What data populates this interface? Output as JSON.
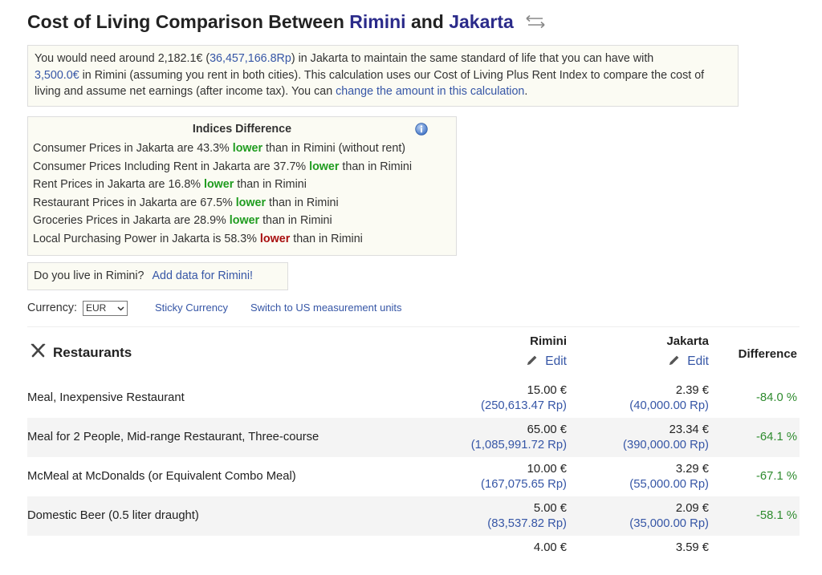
{
  "title": {
    "prefix": "Cost of Living Comparison Between",
    "city1": "Rimini",
    "and": "and",
    "city2": "Jakarta"
  },
  "summary": {
    "t1": "You would need around 2,182.1€ (",
    "amount_rp": "36,457,166.8Rp",
    "t2": ") in Jakarta to maintain the same standard of life that you can have with",
    "amount_eur": "3,500.0€",
    "t3": " in Rimini (assuming you rent in both cities). This calculation uses our Cost of Living Plus Rent Index to compare the cost of living and assume net earnings (after income tax). You can ",
    "link": "change the amount in this calculation",
    "t4": "."
  },
  "indices": {
    "heading": "Indices Difference",
    "rows": [
      {
        "pre": "Consumer Prices in Jakarta are 43.3% ",
        "word": "lower",
        "post": " than in Rimini (without rent)"
      },
      {
        "pre": "Consumer Prices Including Rent in Jakarta are 37.7% ",
        "word": "lower",
        "post": " than in Rimini"
      },
      {
        "pre": "Rent Prices in Jakarta are 16.8% ",
        "word": "lower",
        "post": " than in Rimini"
      },
      {
        "pre": "Restaurant Prices in Jakarta are 67.5% ",
        "word": "lower",
        "post": " than in Rimini"
      },
      {
        "pre": "Groceries Prices in Jakarta are 28.9% ",
        "word": "lower",
        "post": " than in Rimini"
      },
      {
        "pre": "Local Purchasing Power in Jakarta is 58.3% ",
        "word": "lower",
        "post": " than in Rimini"
      }
    ]
  },
  "live": {
    "question": "Do you live in Rimini?",
    "link": "Add data for Rimini!"
  },
  "currency": {
    "label": "Currency:",
    "selected": "EUR",
    "sticky": "Sticky Currency",
    "units": "Switch to US measurement units"
  },
  "table": {
    "category": "Restaurants",
    "col_rimini": "Rimini",
    "col_jakarta": "Jakarta",
    "edit": "Edit",
    "col_difference": "Difference",
    "rows": [
      {
        "item": "Meal, Inexpensive Restaurant",
        "rim_eur": "15.00 €",
        "rim_rp": "(250,613.47 Rp)",
        "jak_eur": "2.39 €",
        "jak_rp": "(40,000.00 Rp)",
        "diff": "-84.0 %"
      },
      {
        "item": "Meal for 2 People, Mid-range Restaurant, Three-course",
        "rim_eur": "65.00 €",
        "rim_rp": "(1,085,991.72 Rp)",
        "jak_eur": "23.34 €",
        "jak_rp": "(390,000.00 Rp)",
        "diff": "-64.1 %"
      },
      {
        "item": "McMeal at McDonalds (or Equivalent Combo Meal)",
        "rim_eur": "10.00 €",
        "rim_rp": "(167,075.65 Rp)",
        "jak_eur": "3.29 €",
        "jak_rp": "(55,000.00 Rp)",
        "diff": "-67.1 %"
      },
      {
        "item": "Domestic Beer (0.5 liter draught)",
        "rim_eur": "5.00 €",
        "rim_rp": "(83,537.82 Rp)",
        "jak_eur": "2.09 €",
        "jak_rp": "(35,000.00 Rp)",
        "diff": "-58.1 %"
      },
      {
        "item": "",
        "rim_eur": "4.00 €",
        "rim_rp": "",
        "jak_eur": "3.59 €",
        "jak_rp": "",
        "diff": ""
      }
    ]
  },
  "colors": {
    "link": "#3656a6",
    "city": "#2b2b8a",
    "lower_green": "#1f9c1f",
    "lower_red": "#a80e0e",
    "diff_green": "#2e8b2e"
  }
}
